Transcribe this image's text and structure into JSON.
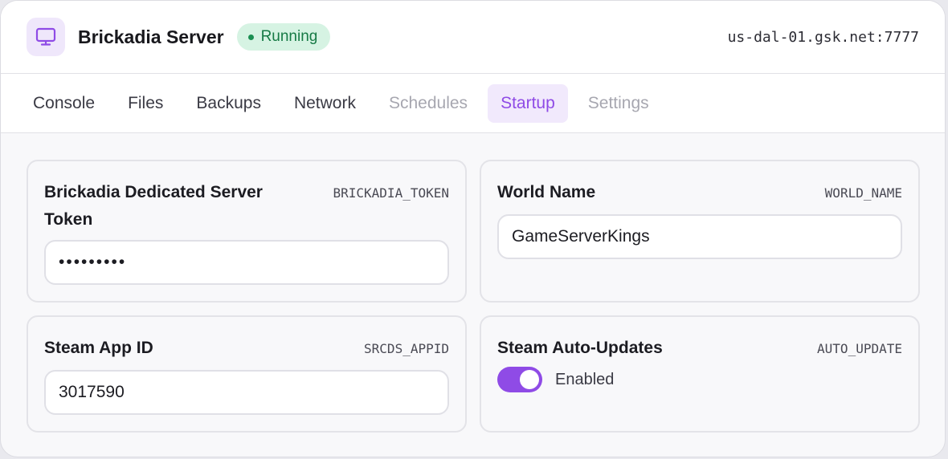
{
  "header": {
    "title": "Brickadia Server",
    "status": "Running",
    "address": "us-dal-01.gsk.net:7777"
  },
  "icons": {
    "app": "monitor-icon"
  },
  "colors": {
    "accent": "#8f4be6",
    "status_bg": "#d6f3e3",
    "status_text": "#167a45"
  },
  "tabs": [
    {
      "label": "Console",
      "state": "normal"
    },
    {
      "label": "Files",
      "state": "normal"
    },
    {
      "label": "Backups",
      "state": "normal"
    },
    {
      "label": "Network",
      "state": "normal"
    },
    {
      "label": "Schedules",
      "state": "disabled"
    },
    {
      "label": "Startup",
      "state": "active"
    },
    {
      "label": "Settings",
      "state": "disabled"
    }
  ],
  "variables": {
    "token": {
      "label_line1": "Brickadia Dedicated Server",
      "label_line2": "Token",
      "var": "BRICKADIA_TOKEN",
      "value": "•••••••••"
    },
    "world": {
      "label": "World Name",
      "var": "WORLD_NAME",
      "value": "GameServerKings"
    },
    "appid": {
      "label": "Steam App ID",
      "var": "SRCDS_APPID",
      "value": "3017590"
    },
    "autoupdate": {
      "label": "Steam Auto-Updates",
      "var": "AUTO_UPDATE",
      "toggle_on": true,
      "state_text": "Enabled"
    }
  }
}
